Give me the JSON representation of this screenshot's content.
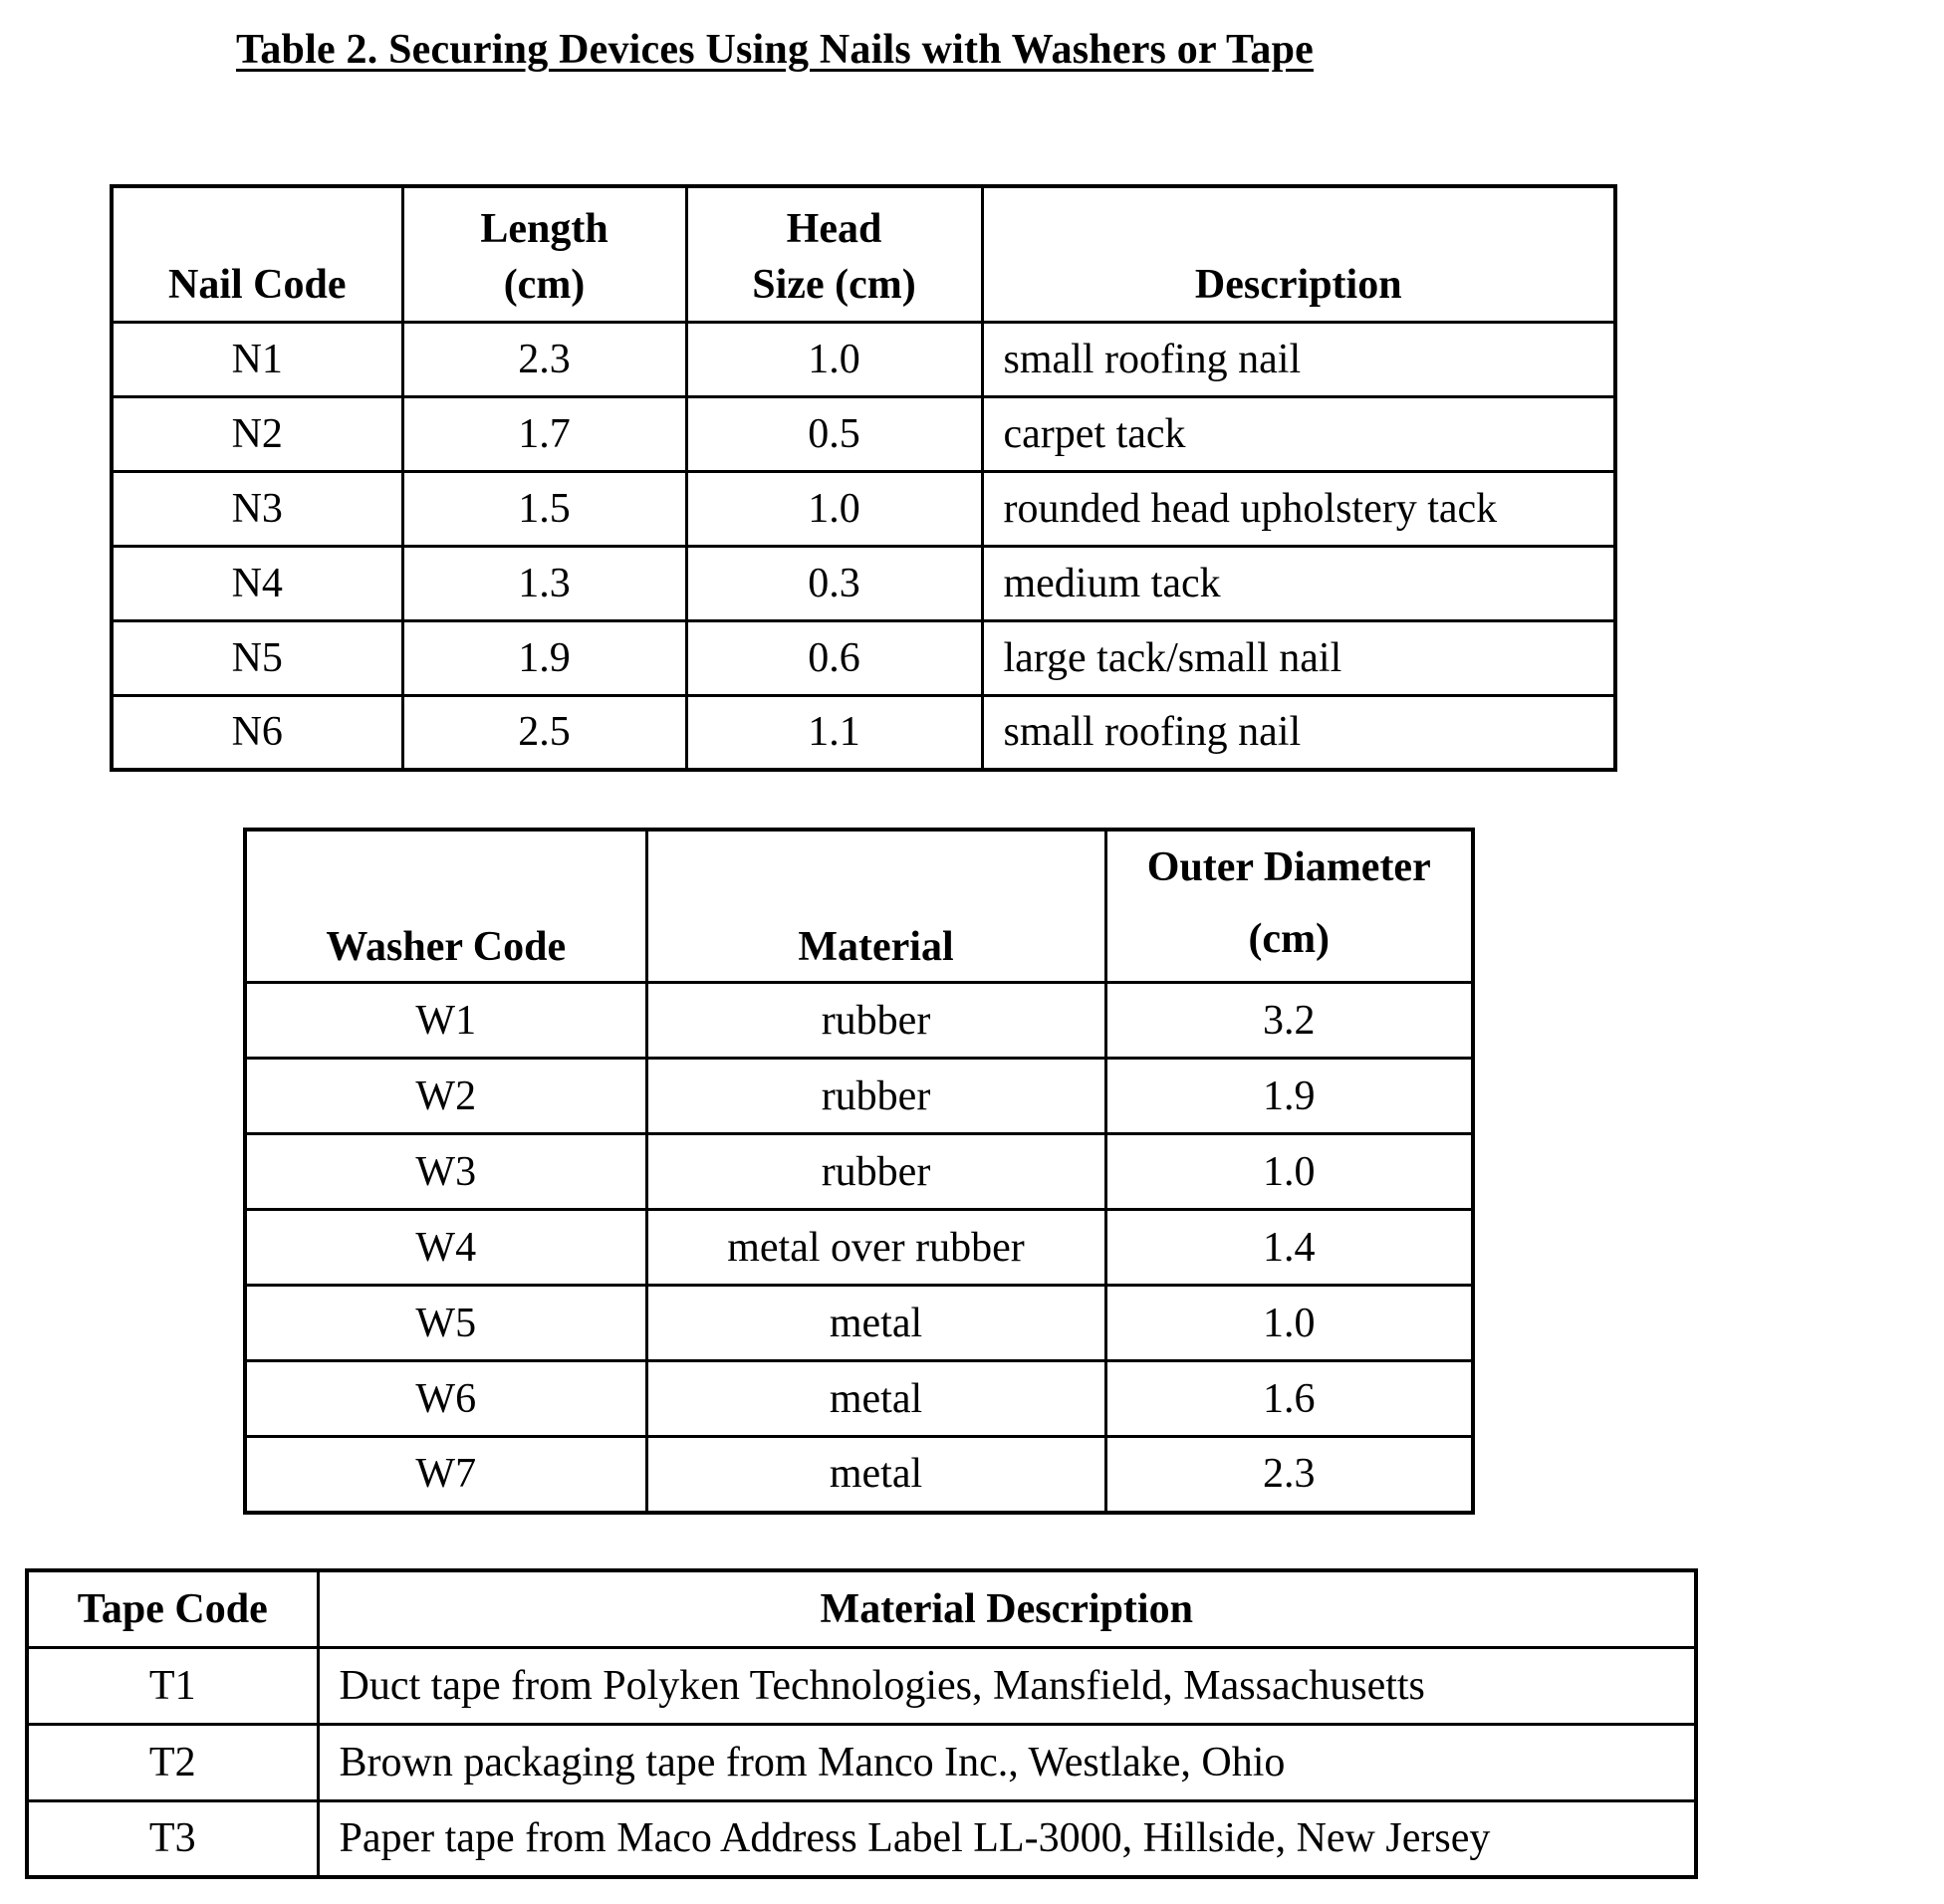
{
  "title": "Table 2.  Securing Devices Using Nails with Washers or Tape",
  "nail_table": {
    "headers": {
      "code": "Nail Code",
      "length_line1": "Length",
      "length_line2": "(cm)",
      "head_line1": "Head",
      "head_line2": "Size (cm)",
      "description": "Description"
    },
    "rows": [
      {
        "code": "N1",
        "length": "2.3",
        "head": "1.0",
        "description": "small roofing nail"
      },
      {
        "code": "N2",
        "length": "1.7",
        "head": "0.5",
        "description": "carpet tack"
      },
      {
        "code": "N3",
        "length": "1.5",
        "head": "1.0",
        "description": "rounded head upholstery tack"
      },
      {
        "code": "N4",
        "length": "1.3",
        "head": "0.3",
        "description": "medium tack"
      },
      {
        "code": "N5",
        "length": "1.9",
        "head": "0.6",
        "description": "large tack/small nail"
      },
      {
        "code": "N6",
        "length": "2.5",
        "head": "1.1",
        "description": "small roofing nail"
      }
    ]
  },
  "washer_table": {
    "headers": {
      "code": "Washer Code",
      "material": "Material",
      "diameter_line1": "Outer Diameter",
      "diameter_line2": "(cm)"
    },
    "rows": [
      {
        "code": "W1",
        "material": "rubber",
        "diameter": "3.2"
      },
      {
        "code": "W2",
        "material": "rubber",
        "diameter": "1.9"
      },
      {
        "code": "W3",
        "material": "rubber",
        "diameter": "1.0"
      },
      {
        "code": "W4",
        "material": "metal over rubber",
        "diameter": "1.4"
      },
      {
        "code": "W5",
        "material": "metal",
        "diameter": "1.0"
      },
      {
        "code": "W6",
        "material": "metal",
        "diameter": "1.6"
      },
      {
        "code": "W7",
        "material": "metal",
        "diameter": "2.3"
      }
    ]
  },
  "tape_table": {
    "headers": {
      "code": "Tape Code",
      "description": "Material Description"
    },
    "rows": [
      {
        "code": "T1",
        "description": "Duct tape from Polyken Technologies, Mansfield, Massachusetts"
      },
      {
        "code": "T2",
        "description": "Brown packaging tape from Manco Inc., Westlake, Ohio"
      },
      {
        "code": "T3",
        "description": "Paper tape from Maco Address Label LL-3000, Hillside, New Jersey"
      }
    ]
  }
}
